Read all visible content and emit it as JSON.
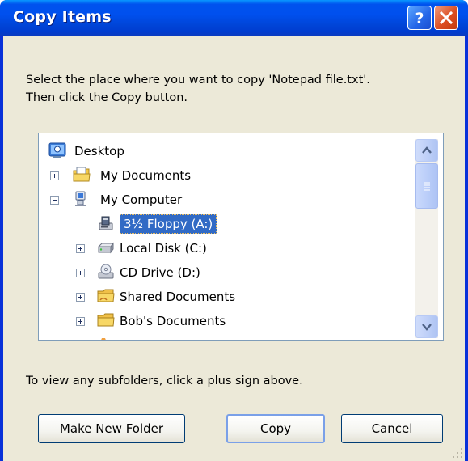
{
  "window": {
    "title": "Copy Items",
    "help_label": "?",
    "close_label": "✕"
  },
  "prompt": {
    "line1": "Select the place where you want to copy 'Notepad file.txt'.",
    "line2": "Then click the Copy button."
  },
  "tree": {
    "items": [
      {
        "label": "Desktop",
        "icon": "desktop-icon",
        "expander": "none"
      },
      {
        "label": "My Documents",
        "icon": "my-documents-icon",
        "expander": "plus"
      },
      {
        "label": "My Computer",
        "icon": "my-computer-icon",
        "expander": "minus"
      },
      {
        "label": "3½ Floppy (A:)",
        "icon": "floppy-drive-icon",
        "expander": "none",
        "selected": true
      },
      {
        "label": "Local Disk (C:)",
        "icon": "hard-disk-icon",
        "expander": "plus"
      },
      {
        "label": "CD Drive (D:)",
        "icon": "cd-drive-icon",
        "expander": "plus"
      },
      {
        "label": "Shared Documents",
        "icon": "shared-folder-icon",
        "expander": "plus"
      },
      {
        "label": "Bob's Documents",
        "icon": "folder-icon",
        "expander": "plus"
      }
    ]
  },
  "hint": "To view any subfolders, click a plus sign above.",
  "buttons": {
    "make_new_folder": {
      "accel": "M",
      "rest": "ake New Folder"
    },
    "copy": "Copy",
    "cancel": "Cancel"
  },
  "colors": {
    "title_bar": "#0053ee",
    "dialog_face": "#ece9d8",
    "selection": "#316ac5",
    "close_button": "#dc4e22"
  }
}
